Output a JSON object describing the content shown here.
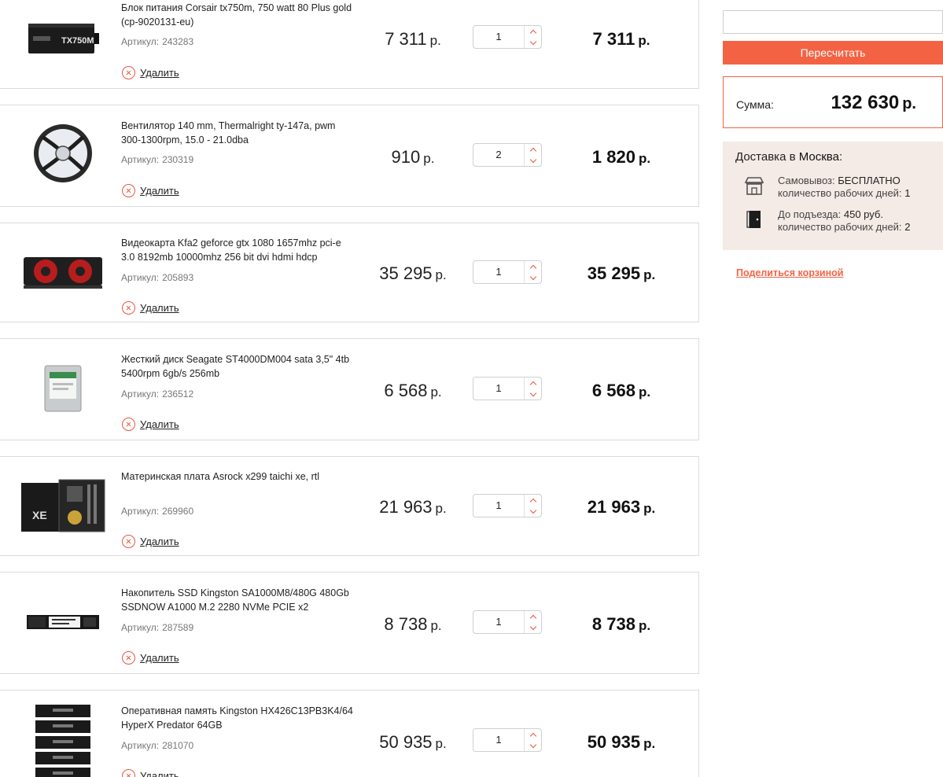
{
  "items": [
    {
      "name": "Блок питания Corsair tx750m, 750 watt 80 Plus gold (cp-9020131-eu)",
      "sku_label": "Артикул:",
      "sku": "243283",
      "price": "7 311",
      "qty": "1",
      "total": "7 311",
      "image": "power-supply-image"
    },
    {
      "name": "Вентилятор 140 mm, Thermalright ty-147a, pwm 300-1300rpm, 15.0 - 21.0dba",
      "sku_label": "Артикул:",
      "sku": "230319",
      "price": "910",
      "qty": "2",
      "total": "1 820",
      "image": "fan-image"
    },
    {
      "name": "Видеокарта Kfa2 geforce gtx 1080 1657mhz pci-e 3.0 8192mb 10000mhz 256 bit dvi hdmi hdcp",
      "sku_label": "Артикул:",
      "sku": "205893",
      "price": "35 295",
      "qty": "1",
      "total": "35 295",
      "image": "graphics-card-image"
    },
    {
      "name": "Жесткий диск Seagate ST4000DM004 sata 3,5\" 4tb 5400rpm 6gb/s 256mb",
      "sku_label": "Артикул:",
      "sku": "236512",
      "price": "6 568",
      "qty": "1",
      "total": "6 568",
      "image": "hard-drive-image"
    },
    {
      "name": "Материнская плата Asrock x299 taichi xe, rtl",
      "sku_label": "Артикул:",
      "sku": "269960",
      "price": "21 963",
      "qty": "1",
      "total": "21 963",
      "image": "motherboard-image"
    },
    {
      "name": "Накопитель SSD Kingston SA1000M8/480G 480Gb SSDNOW A1000 M.2 2280 NVMe PCIE x2",
      "sku_label": "Артикул:",
      "sku": "287589",
      "price": "8 738",
      "qty": "1",
      "total": "8 738",
      "image": "ssd-image"
    },
    {
      "name": "Оперативная память Kingston HX426C13PB3K4/64 HyperX Predator 64GB",
      "sku_label": "Артикул:",
      "sku": "281070",
      "price": "50 935",
      "qty": "1",
      "total": "50 935",
      "image": "ram-image"
    }
  ],
  "labels": {
    "delete": "Удалить",
    "currency": "р."
  },
  "sidebar": {
    "promo_value": "",
    "recalc_label": "Пересчитать",
    "sum_label": "Сумма:",
    "sum_value": "132 630",
    "currency": "р.",
    "delivery": {
      "title_prefix": "Доставка в ",
      "city": "Москва",
      "title_suffix": ":",
      "options": [
        {
          "icon": "store-icon",
          "name": "Самовывоз:",
          "value": "БЕСПЛАТНО",
          "days_label": "количество рабочих дней:",
          "days": "1"
        },
        {
          "icon": "door-icon",
          "name": "До подъезда:",
          "value": "450 руб.",
          "days_label": "количество рабочих дней:",
          "days": "2"
        }
      ]
    },
    "share_label": "Поделиться корзиной"
  },
  "colors": {
    "accent": "#f36343",
    "delivery_bg": "#f4ebe6",
    "border": "#dcdcdc"
  }
}
